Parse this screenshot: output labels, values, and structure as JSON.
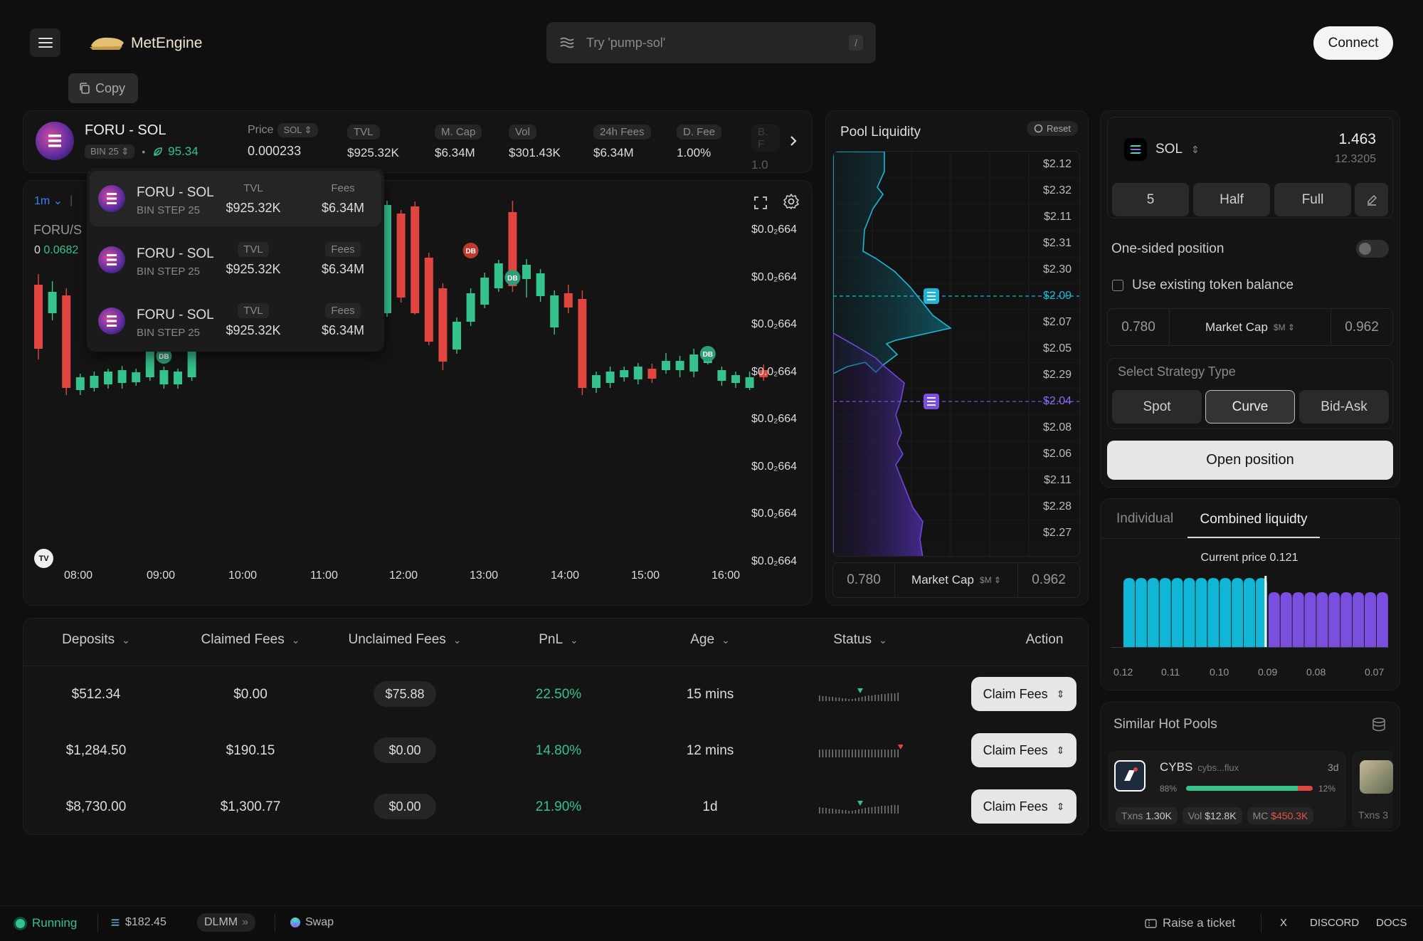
{
  "header": {
    "brand": "MetEngine",
    "search_placeholder": "Try 'pump-sol'",
    "search_shortcut": "/",
    "connect_label": "Connect",
    "copy_label": "Copy"
  },
  "pool": {
    "name": "FORU - SOL",
    "bin": "BIN 25",
    "score": "95.34",
    "price_label": "Price",
    "price_unit": "SOL",
    "price": "0.000233",
    "stats": [
      {
        "label": "TVL",
        "value": "$925.32K"
      },
      {
        "label": "M. Cap",
        "value": "$6.34M"
      },
      {
        "label": "Vol",
        "value": "$301.43K"
      },
      {
        "label": "24h Fees",
        "value": "$6.34M"
      },
      {
        "label": "D. Fee",
        "value": "1.00%"
      },
      {
        "label": "B. F",
        "value": "1.0"
      }
    ]
  },
  "dropdown": {
    "items": [
      {
        "name": "FORU - SOL",
        "sub": "BIN STEP 25",
        "tvl_label": "TVL",
        "tvl": "$925.32K",
        "fees_label": "Fees",
        "fees": "$6.34M"
      },
      {
        "name": "FORU - SOL",
        "sub": "BIN STEP 25",
        "tvl_label": "TVL",
        "tvl": "$925.32K",
        "fees_label": "Fees",
        "fees": "$6.34M"
      },
      {
        "name": "FORU - SOL",
        "sub": "BIN STEP 25",
        "tvl_label": "TVL",
        "tvl": "$925.32K",
        "fees_label": "Fees",
        "fees": "$6.34M"
      }
    ]
  },
  "chart": {
    "interval": "1m",
    "symbol": "FORU/S",
    "ohlc_o": "0",
    "ohlc_val": "0.0682",
    "price_axis": [
      "$0.0₂664",
      "$0.0₂664",
      "$0.0₂664",
      "$0.0₂664",
      "$0.0₂664",
      "$0.0₂664",
      "$0.0₂664",
      "$0.0₂664"
    ],
    "time_axis": [
      "08:00",
      "09:00",
      "10:00",
      "11:00",
      "12:00",
      "13:00",
      "14:00",
      "15:00",
      "16:00"
    ],
    "marker_label": "DB",
    "tv_logo": "TV",
    "candles": [
      {
        "o": 400,
        "c": 490,
        "h": 385,
        "l": 505
      },
      {
        "o": 440,
        "c": 410,
        "h": 395,
        "l": 450
      },
      {
        "o": 415,
        "c": 545,
        "h": 405,
        "l": 555
      },
      {
        "o": 548,
        "c": 530,
        "h": 525,
        "l": 555
      },
      {
        "o": 545,
        "c": 528,
        "h": 522,
        "l": 550
      },
      {
        "o": 540,
        "c": 522,
        "h": 518,
        "l": 546
      },
      {
        "o": 538,
        "c": 520,
        "h": 514,
        "l": 546
      },
      {
        "o": 537,
        "c": 523,
        "h": 518,
        "l": 542
      },
      {
        "o": 530,
        "c": 488,
        "h": 480,
        "l": 535
      },
      {
        "o": 540,
        "c": 520,
        "h": 515,
        "l": 546
      },
      {
        "o": 540,
        "c": 522,
        "h": 518,
        "l": 546
      },
      {
        "o": 530,
        "c": 440,
        "h": 435,
        "l": 535
      },
      {
        "o": 462,
        "c": 395,
        "h": 385,
        "l": 470
      },
      {
        "o": 445,
        "c": 390,
        "h": 382,
        "l": 450
      },
      {
        "o": 392,
        "c": 437,
        "h": 385,
        "l": 445
      },
      {
        "o": 420,
        "c": 390,
        "h": 385,
        "l": 425
      },
      {
        "o": 410,
        "c": 390,
        "h": 385,
        "l": 415
      },
      {
        "o": 460,
        "c": 395,
        "h": 385,
        "l": 470
      },
      {
        "o": 460,
        "c": 440,
        "h": 435,
        "l": 466
      },
      {
        "o": 452,
        "c": 438,
        "h": 432,
        "l": 458
      },
      {
        "o": 448,
        "c": 434,
        "h": 428,
        "l": 452
      },
      {
        "o": 446,
        "c": 430,
        "h": 425,
        "l": 450
      },
      {
        "o": 440,
        "c": 398,
        "h": 393,
        "l": 445
      },
      {
        "o": 412,
        "c": 372,
        "h": 365,
        "l": 418
      },
      {
        "o": 393,
        "c": 423,
        "h": 388,
        "l": 428
      },
      {
        "o": 440,
        "c": 288,
        "h": 282,
        "l": 445
      },
      {
        "o": 300,
        "c": 418,
        "h": 295,
        "l": 425
      },
      {
        "o": 290,
        "c": 440,
        "h": 283,
        "l": 442
      },
      {
        "o": 362,
        "c": 480,
        "h": 355,
        "l": 485
      },
      {
        "o": 405,
        "c": 508,
        "h": 398,
        "l": 520
      },
      {
        "o": 491,
        "c": 452,
        "h": 446,
        "l": 497
      },
      {
        "o": 452,
        "c": 412,
        "h": 405,
        "l": 458
      },
      {
        "o": 428,
        "c": 390,
        "h": 383,
        "l": 433
      },
      {
        "o": 405,
        "c": 370,
        "h": 365,
        "l": 410
      },
      {
        "o": 298,
        "c": 402,
        "h": 282,
        "l": 410
      },
      {
        "o": 392,
        "c": 372,
        "h": 364,
        "l": 418
      },
      {
        "o": 416,
        "c": 384,
        "h": 378,
        "l": 424
      },
      {
        "o": 460,
        "c": 415,
        "h": 408,
        "l": 470
      },
      {
        "o": 412,
        "c": 432,
        "h": 400,
        "l": 440
      },
      {
        "o": 420,
        "c": 545,
        "h": 408,
        "l": 555
      },
      {
        "o": 545,
        "c": 527,
        "h": 522,
        "l": 552
      },
      {
        "o": 538,
        "c": 522,
        "h": 515,
        "l": 545
      },
      {
        "o": 530,
        "c": 520,
        "h": 515,
        "l": 536
      },
      {
        "o": 533,
        "c": 515,
        "h": 510,
        "l": 540
      },
      {
        "o": 518,
        "c": 532,
        "h": 511,
        "l": 538
      },
      {
        "o": 520,
        "c": 507,
        "h": 496,
        "l": 525
      },
      {
        "o": 520,
        "c": 507,
        "h": 500,
        "l": 530
      },
      {
        "o": 522,
        "c": 498,
        "h": 490,
        "l": 530
      },
      {
        "o": 510,
        "c": 500,
        "h": 495,
        "l": 512
      },
      {
        "o": 535,
        "c": 520,
        "h": 515,
        "l": 542
      },
      {
        "o": 538,
        "c": 527,
        "h": 522,
        "l": 545
      },
      {
        "o": 545,
        "c": 530,
        "h": 522,
        "l": 548
      },
      {
        "o": 520,
        "c": 530,
        "h": 512,
        "l": 535
      }
    ],
    "markers": [
      {
        "i": 9,
        "p": 500,
        "color": "green"
      },
      {
        "i": 21,
        "p": 420,
        "color": "green"
      },
      {
        "i": 31,
        "p": 352,
        "color": "red"
      },
      {
        "i": 34,
        "p": 390,
        "color": "green"
      },
      {
        "i": 48,
        "p": 497,
        "color": "green"
      }
    ]
  },
  "liquidity": {
    "title": "Pool Liquidity",
    "reset_label": "Reset",
    "prices": [
      "$2.12",
      "$2.32",
      "$2.11",
      "$2.31",
      "$2.30",
      "$2.09",
      "$2.07",
      "$2.05",
      "$2.29",
      "$2.04",
      "$2.08",
      "$2.06",
      "$2.11",
      "$2.28",
      "$2.27"
    ],
    "highlight_upper": "$2.09",
    "highlight_lower": "$2.04",
    "min": "0.780",
    "mid_label": "Market Cap",
    "mid_unit": "$M",
    "max": "0.962"
  },
  "positions": {
    "columns": [
      "Deposits",
      "Claimed Fees",
      "Unclaimed Fees",
      "PnL",
      "Age",
      "Status",
      "Action"
    ],
    "rows": [
      {
        "deposits": "$512.34",
        "claimed": "$0.00",
        "unclaimed": "$75.88",
        "pnl": "22.50%",
        "age": "15 mins",
        "action": "Claim Fees"
      },
      {
        "deposits": "$1,284.50",
        "claimed": "$190.15",
        "unclaimed": "$0.00",
        "pnl": "14.80%",
        "age": "12 mins",
        "action": "Claim Fees"
      },
      {
        "deposits": "$8,730.00",
        "claimed": "$1,300.77",
        "unclaimed": "$0.00",
        "pnl": "21.90%",
        "age": "1d",
        "action": "Claim Fees"
      }
    ]
  },
  "deposit": {
    "token": "SOL",
    "amount": "1.463",
    "amount_usd": "12.3205",
    "quick": [
      "5",
      "Half",
      "Full"
    ],
    "one_sided_label": "One-sided position",
    "use_balance_label": "Use existing token balance",
    "min": "0.780",
    "mid_label": "Market Cap",
    "mid_unit": "$M",
    "max": "0.962",
    "strategy_title": "Select Strategy Type",
    "strategies": [
      "Spot",
      "Curve",
      "Bid-Ask"
    ],
    "selected_strategy": "Curve",
    "open_label": "Open position"
  },
  "combined": {
    "tabs": [
      "Individual",
      "Combined liquidty"
    ],
    "current_price": "Current price 0.121",
    "axis": [
      "0.12",
      "0.11",
      "0.10",
      "0.09",
      "0.08",
      "0.07"
    ],
    "bars_cyan": 12,
    "bars_purple": 10
  },
  "hot_pools": {
    "title": "Similar Hot Pools",
    "card": {
      "symbol": "CYBS",
      "sub": "cybs...flux",
      "age": "3d",
      "pct_left": "88%",
      "pct_right": "12%",
      "left_share": 0.88,
      "txns_label": "Txns",
      "txns": "1.30K",
      "vol_label": "Vol",
      "vol": "$12.8K",
      "mc_label": "MC",
      "mc": "$450.3K"
    },
    "card2_txns_label": "Txns",
    "card2_txns": "3"
  },
  "footer": {
    "status": "Running",
    "sol_price": "$182.45",
    "dlmm": "DLMM",
    "swap": "Swap",
    "ticket": "Raise a ticket",
    "x": "X",
    "discord": "DISCORD",
    "docs": "DOCS"
  },
  "colors": {
    "green": "#36c28c",
    "red": "#e0453f",
    "cyan": "#0fb6d6",
    "purple": "#7a4fe0",
    "accent_red": "#e05545"
  }
}
